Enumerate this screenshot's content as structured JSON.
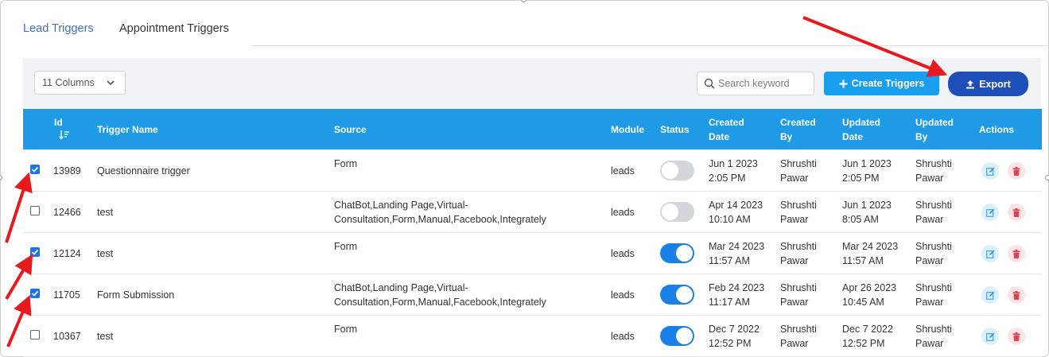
{
  "tabs": [
    {
      "label": "Lead Triggers"
    },
    {
      "label": "Appointment Triggers"
    }
  ],
  "toolbar": {
    "columns_label": "11 Columns",
    "search_placeholder": "Search keyword",
    "create_label": "Create Triggers",
    "export_label": "Export"
  },
  "headers": {
    "id": "Id",
    "name": "Trigger Name",
    "source": "Source",
    "module": "Module",
    "status": "Status",
    "created_date_1": "Created",
    "created_date_2": "Date",
    "created_by_1": "Created",
    "created_by_2": "By",
    "updated_date_1": "Updated",
    "updated_date_2": "Date",
    "updated_by_1": "Updated",
    "updated_by_2": "By",
    "actions": "Actions"
  },
  "rows": [
    {
      "checked": true,
      "id": "13989",
      "name": "Questionnaire trigger",
      "source_1": "Form",
      "source_2": "",
      "module": "leads",
      "status_on": false,
      "c1": "Jun 1 2023",
      "c2": "2:05 PM",
      "cb1": "Shrushti",
      "cb2": "Pawar",
      "u1": "Jun 1 2023",
      "u2": "2:05 PM",
      "ub1": "Shrushti",
      "ub2": "Pawar"
    },
    {
      "checked": false,
      "id": "12466",
      "name": "test",
      "source_1": "ChatBot,Landing Page,Virtual-",
      "source_2": "Consultation,Form,Manual,Facebook,Integrately",
      "module": "leads",
      "status_on": false,
      "c1": "Apr 14 2023",
      "c2": "10:10 AM",
      "cb1": "Shrushti",
      "cb2": "Pawar",
      "u1": "Jun 1 2023",
      "u2": "8:05 AM",
      "ub1": "Shrushti",
      "ub2": "Pawar"
    },
    {
      "checked": true,
      "id": "12124",
      "name": "test",
      "source_1": "Form",
      "source_2": "",
      "module": "leads",
      "status_on": true,
      "c1": "Mar 24 2023",
      "c2": "11:57 AM",
      "cb1": "Shrushti",
      "cb2": "Pawar",
      "u1": "Mar 24 2023",
      "u2": "11:57 AM",
      "ub1": "Shrushti",
      "ub2": "Pawar"
    },
    {
      "checked": true,
      "id": "11705",
      "name": "Form Submission",
      "source_1": "ChatBot,Landing Page,Virtual-",
      "source_2": "Consultation,Form,Manual,Facebook,Integrately",
      "module": "leads",
      "status_on": true,
      "c1": "Feb 24 2023",
      "c2": "11:17 AM",
      "cb1": "Shrushti",
      "cb2": "Pawar",
      "u1": "Apr 26 2023",
      "u2": "10:45 AM",
      "ub1": "Shrushti",
      "ub2": "Pawar"
    },
    {
      "checked": false,
      "id": "10367",
      "name": "test",
      "source_1": "Form",
      "source_2": "",
      "module": "leads",
      "status_on": true,
      "c1": "Dec 7 2022",
      "c2": "12:52 PM",
      "cb1": "Shrushti",
      "cb2": "Pawar",
      "u1": "Dec 7 2022",
      "u2": "12:52 PM",
      "ub1": "Shrushti",
      "ub2": "Pawar"
    }
  ],
  "colors": {
    "header_bg": "#1e9be4",
    "create_bg": "#1a9ef0",
    "export_bg": "#1e4fb8",
    "toggle_on": "#1a80e8",
    "annotation_arrow": "#e8191c"
  }
}
